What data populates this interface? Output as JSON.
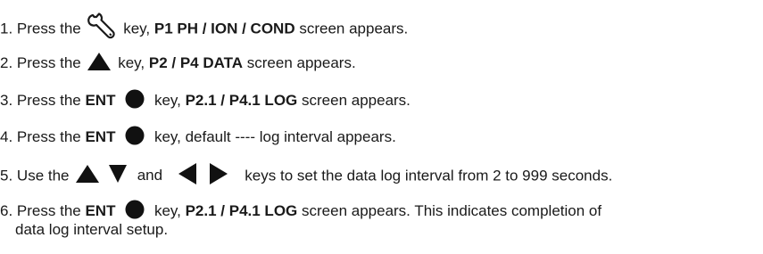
{
  "steps": [
    {
      "number": "1.",
      "text_a": "Press the",
      "icon": "wrench-icon",
      "text_b": "key,",
      "bold": "P1 PH / ION / COND",
      "text_c": "screen appears."
    },
    {
      "number": "2.",
      "text_a": "Press the",
      "icon": "up-triangle-icon",
      "text_b": "key,",
      "bold": "P2 / P4 DATA",
      "text_c": "screen appears."
    },
    {
      "number": "3.",
      "text_a": "Press the",
      "bold_key": "ENT",
      "icon": "filled-circle-icon",
      "text_b": "key,",
      "bold": "P2.1 / P4.1 LOG",
      "text_c": "screen appears."
    },
    {
      "number": "4.",
      "text_a": "Press the",
      "bold_key": "ENT",
      "icon": "filled-circle-icon",
      "text_b": "key, default ---- log interval appears."
    },
    {
      "number": "5.",
      "text_a": "Use the",
      "icons": [
        "up-triangle-icon",
        "down-triangle-icon",
        "left-triangle-icon",
        "right-triangle-icon"
      ],
      "and": "and",
      "text_b": "keys to set the data log interval from 2 to 999 seconds."
    },
    {
      "number": "6.",
      "text_a": "Press the",
      "bold_key": "ENT",
      "icon": "filled-circle-icon",
      "text_b": "key,",
      "bold": "P2.1 / P4.1 LOG",
      "text_c": "screen appears. This indicates completion of",
      "text_d": "data log interval setup."
    }
  ]
}
